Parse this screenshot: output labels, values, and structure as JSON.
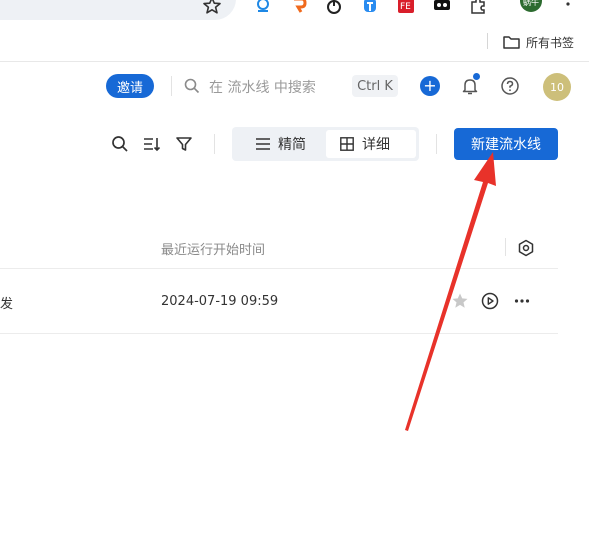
{
  "browser": {
    "bookmarks_label": "所有书签",
    "profile_label": "蜗牛"
  },
  "header": {
    "invite_label": "邀请",
    "search_placeholder": "在 流水线 中搜索",
    "shortcut": "Ctrl K",
    "avatar_text": "10"
  },
  "toolbar": {
    "view_simple": "精简",
    "view_detail": "详细",
    "new_pipeline": "新建流水线"
  },
  "table": {
    "column_last_run": "最近运行开始时间",
    "rows": [
      {
        "name_fragment": "发",
        "last_run": "2024-07-19 09:59"
      }
    ]
  },
  "colors": {
    "accent": "#1769d6",
    "annotation_arrow": "#e8322a"
  }
}
